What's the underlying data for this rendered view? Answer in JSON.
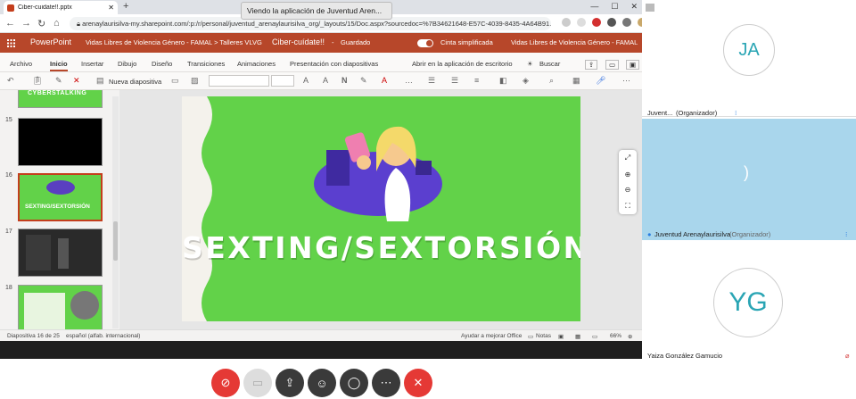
{
  "browser": {
    "tab_title": "Ciber-cuidate!!.pptx",
    "tooltip": "Viendo la aplicación de Juventud Aren...",
    "url": "arenaylaurisilva-my.sharepoint.com/:p:/r/personal/juventud_arenaylaurisilva_org/_layouts/15/Doc.aspx?sourcedoc=%7B34621648-E57C-4039-8435-4A64B91..."
  },
  "office": {
    "app": "PowerPoint",
    "breadcrumb": "Vidas Libres de Violencia Género - FAMAL  >  Talleres VLVG",
    "doc_title": "Ciber-cuídate!!",
    "dash": "-",
    "save_state": "Guardado",
    "simplified_ribbon": "Cinta simplificada",
    "org": "Vidas Libres de Violencia Género - FAMAL"
  },
  "menu": {
    "items": [
      "Archivo",
      "Inicio",
      "Insertar",
      "Dibujo",
      "Diseño",
      "Transiciones",
      "Animaciones",
      "Presentación con diapositivas",
      "Abrir en la aplicación de escritorio"
    ],
    "search": "Buscar"
  },
  "toolbar": {
    "new_slide": "Nueva diapositiva"
  },
  "thumbnails": [
    {
      "num": "15",
      "caption": ""
    },
    {
      "num": "16",
      "caption": "SEXTING/SEXTORSIÓN"
    },
    {
      "num": "17",
      "caption": ""
    },
    {
      "num": "18",
      "caption": ""
    }
  ],
  "thumb_top_caption": "CYBERSTALKING",
  "slide": {
    "title": "SEXTING/SEXTORSIÓN"
  },
  "status": {
    "slide_pos": "Diapositiva 16 de 25",
    "language": "español (alfab. internacional)",
    "help": "Ayudar a mejorar Office",
    "notes": "Notas",
    "zoom": "66%"
  },
  "meeting": {
    "p1_initials": "JA",
    "p1_label_short": "Juvent...",
    "p1_role": "(Organizador)",
    "p2_name": "Juventud Arenaylaurisilva",
    "p2_role": "(Organizador)",
    "p3_initials": "YG",
    "p3_name": "Yaiza González Gamucio"
  },
  "colors": {
    "office_red": "#b7472a",
    "slide_green": "#62d249",
    "avatar_text": "#2aa5b4",
    "hangup": "#e53935"
  }
}
